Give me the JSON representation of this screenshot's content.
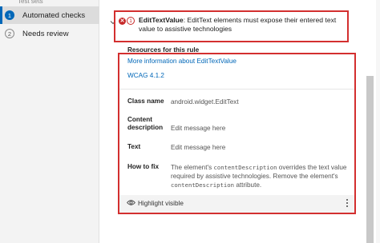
{
  "sidebar": {
    "top_partial": "Test sets",
    "items": [
      {
        "step": "1",
        "label": "Automated checks",
        "active": true
      },
      {
        "step": "2",
        "label": "Needs review",
        "active": false
      }
    ]
  },
  "rule": {
    "error_icon": "error-x-icon",
    "count": "1",
    "name": "EditTextValue",
    "description": ": EditText elements must expose their entered text value to assistive technologies"
  },
  "resources": {
    "title": "Resources for this rule",
    "links": [
      "More information about EditTextValue",
      "WCAG 4.1.2"
    ]
  },
  "details": [
    {
      "label": "Class name",
      "value": "android.widget.EditText"
    },
    {
      "label": "Content description",
      "value": "Edit message here"
    },
    {
      "label": "Text",
      "value": "Edit message here"
    }
  ],
  "how_to_fix": {
    "label": "How to fix",
    "part1": "The element's ",
    "code1": "contentDescription",
    "part2": " overrides the text value required by assistive technologies. Remove the element's ",
    "code2": "contentDescription",
    "part3": " attribute."
  },
  "footer": {
    "highlight_label": "Highlight visible",
    "eye_icon": "eye-icon",
    "more_icon": "more-options-icon"
  },
  "colors": {
    "accent": "#0067b8",
    "error": "#d32f2f"
  }
}
